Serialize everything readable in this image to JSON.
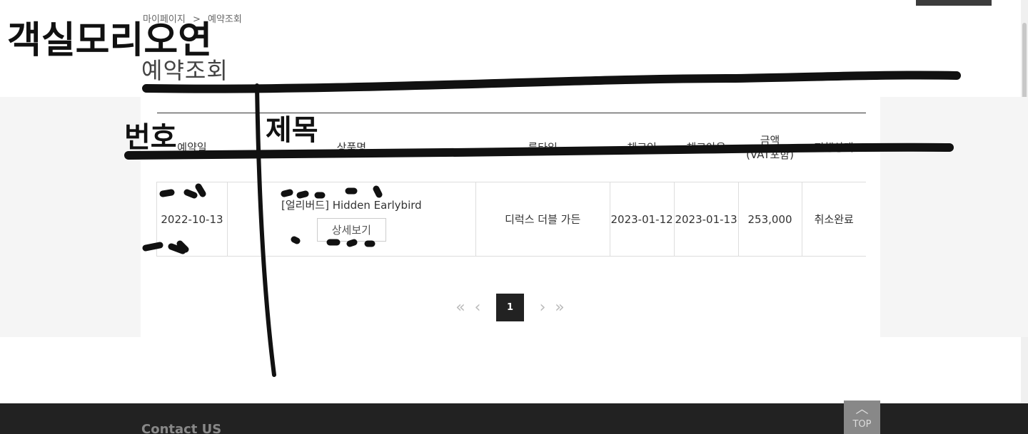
{
  "breadcrumb": {
    "items": [
      "마이페이지",
      "예약조회"
    ],
    "separator": ">"
  },
  "page_title": "예약조회",
  "table": {
    "headers": [
      "예약일",
      "상품명",
      "룸타입",
      "체크인",
      "체크아웃",
      "금액\n(VAT포함)",
      "진행상태"
    ],
    "rows": [
      {
        "date": "2022-10-13",
        "product": "[얼리버드] Hidden Earlybird",
        "detail_label": "상세보기",
        "room": "디럭스 더블 가든",
        "checkin": "2023-01-12",
        "checkout": "2023-01-13",
        "amount": "253,000",
        "status": "취소완료"
      }
    ]
  },
  "pagination": {
    "current": "1",
    "icons": [
      "double-left",
      "left",
      "right",
      "double-right"
    ]
  },
  "footer": {
    "title": "Contact US",
    "top_label": "TOP"
  },
  "annotations": {
    "handwriting_title": "객실모리오연",
    "handwriting_col1": "번호",
    "handwriting_col2": "제목"
  },
  "colors": {
    "ink": "#111111",
    "footer": "#222222",
    "band": "#f5f5f5",
    "active_page": "#222222"
  }
}
